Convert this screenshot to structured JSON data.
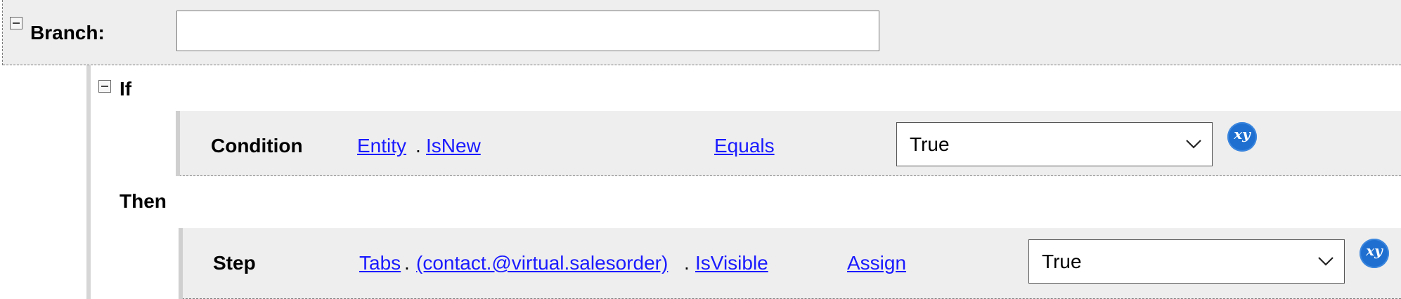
{
  "branch": {
    "label": "Branch:",
    "input_value": ""
  },
  "if_block": {
    "label": "If",
    "condition": {
      "label": "Condition",
      "entity_link": "Entity",
      "separator": ".",
      "field_link": "IsNew",
      "operator_link": "Equals",
      "value": "True",
      "xy_label": "xy"
    }
  },
  "then_block": {
    "label": "Then",
    "step": {
      "label": "Step",
      "path_links": [
        "Tabs",
        "(contact.@virtual.salesorder)",
        "IsVisible"
      ],
      "separator": ".",
      "action_link": "Assign",
      "value": "True",
      "xy_label": "xy"
    }
  },
  "icons": {
    "collapse": "collapse-minus-icon",
    "dropdown": "chevron-down-icon",
    "variable": "xy-variable-icon"
  },
  "colors": {
    "link": "#1a1aff",
    "row_background": "#eeeeee",
    "xy_button": "#1e6fd0"
  }
}
